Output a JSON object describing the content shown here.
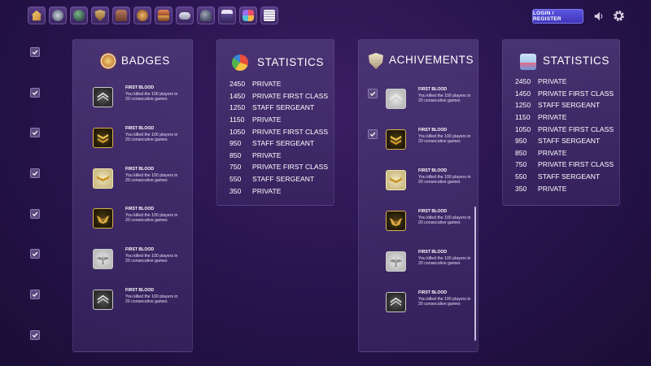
{
  "toolbar": {
    "icons": [
      "home-icon",
      "radar-icon",
      "globe-icon",
      "shield-icon",
      "backpack-icon",
      "compass-icon",
      "chest-icon",
      "gamepad-icon",
      "helmet-icon",
      "store-icon",
      "apps-icon",
      "notes-icon"
    ]
  },
  "header": {
    "login_label": "LOGIN / REGISTER"
  },
  "panels": {
    "badges": {
      "title": "BADGES",
      "items": [
        {
          "name": "FIRST BLOOD",
          "desc": "You killed the 100 players in 20 consecutive games",
          "style": "silver",
          "icon": "chevron-rank-icon"
        },
        {
          "name": "FIRST BLOOD",
          "desc": "You killed the 100 players in 20 consecutive games",
          "style": "gold",
          "icon": "double-chevron-rank-icon"
        },
        {
          "name": "FIRST BLOOD",
          "desc": "You killed the 100 players in 20 consecutive games",
          "style": "goldlight",
          "icon": "gold-chevron-rank-icon"
        },
        {
          "name": "FIRST BLOOD",
          "desc": "You killed the 100 players in 20 consecutive games",
          "style": "gold",
          "icon": "eagle-rank-icon"
        },
        {
          "name": "FIRST BLOOD",
          "desc": "You killed the 100 players in 20 consecutive games",
          "style": "gray",
          "icon": "wings-rank-icon"
        },
        {
          "name": "FIRST BLOOD",
          "desc": "You killed the 100 players in 20 consecutive games",
          "style": "silver",
          "icon": "chevron-rank-icon"
        }
      ]
    },
    "statistics_left": {
      "title": "STATISTICS",
      "rows": [
        {
          "score": "2450",
          "rank": "PRIVATE"
        },
        {
          "score": "1450",
          "rank": "PRIVATE FIRST CLASS"
        },
        {
          "score": "1250",
          "rank": "STAFF SERGEANT"
        },
        {
          "score": "1150",
          "rank": "PRIVATE"
        },
        {
          "score": "1050",
          "rank": "PRIVATE FIRST CLASS"
        },
        {
          "score": "950",
          "rank": "STAFF SERGEANT"
        },
        {
          "score": "850",
          "rank": "PRIVATE"
        },
        {
          "score": "750",
          "rank": "PRIVATE FIRST CLASS"
        },
        {
          "score": "550",
          "rank": "STAFF SERGEANT"
        },
        {
          "score": "350",
          "rank": "PRIVATE"
        }
      ]
    },
    "achievements": {
      "title": "ACHIVEMENTS",
      "items": [
        {
          "name": "FIRST BLOOD",
          "desc": "You killed the 100 players in 20 consecutive games",
          "style": "gray",
          "icon": "chevron-rank-icon",
          "checked": true
        },
        {
          "name": "FIRST BLOOD",
          "desc": "You killed the 100 players in 20 consecutive games",
          "style": "gold",
          "icon": "double-chevron-rank-icon",
          "checked": true
        },
        {
          "name": "FIRST BLOOD",
          "desc": "You killed the 100 players in 20 consecutive games",
          "style": "goldlight",
          "icon": "gold-chevron-rank-icon",
          "checked": false
        },
        {
          "name": "FIRST BLOOD",
          "desc": "You killed the 100 players in 20 consecutive games",
          "style": "gold",
          "icon": "eagle-rank-icon",
          "checked": false
        },
        {
          "name": "FIRST BLOOD",
          "desc": "You killed the 100 players in 20 consecutive games",
          "style": "gray",
          "icon": "wings-rank-icon",
          "checked": false
        },
        {
          "name": "FIRST BLOOD",
          "desc": "You killed the 100 players in 20 consecutive games",
          "style": "silver",
          "icon": "chevron-rank-icon",
          "checked": false
        }
      ]
    },
    "statistics_right": {
      "title": "STATISTICS",
      "rows": [
        {
          "score": "2450",
          "rank": "PRIVATE"
        },
        {
          "score": "1450",
          "rank": "PRIVATE FIRST CLASS"
        },
        {
          "score": "1250",
          "rank": "STAFF SERGEANT"
        },
        {
          "score": "1150",
          "rank": "PRIVATE"
        },
        {
          "score": "1050",
          "rank": "PRIVATE FIRST CLASS"
        },
        {
          "score": "950",
          "rank": "STAFF SERGEANT"
        },
        {
          "score": "850",
          "rank": "PRIVATE"
        },
        {
          "score": "750",
          "rank": "PRIVATE FIRST CLASS"
        },
        {
          "score": "550",
          "rank": "STAFF SERGEANT"
        },
        {
          "score": "350",
          "rank": "PRIVATE"
        }
      ]
    }
  },
  "colors": {
    "accent": "#4f46d8",
    "panel": "#4e3878",
    "background": "#2a1550",
    "gold": "#d8b24c"
  }
}
